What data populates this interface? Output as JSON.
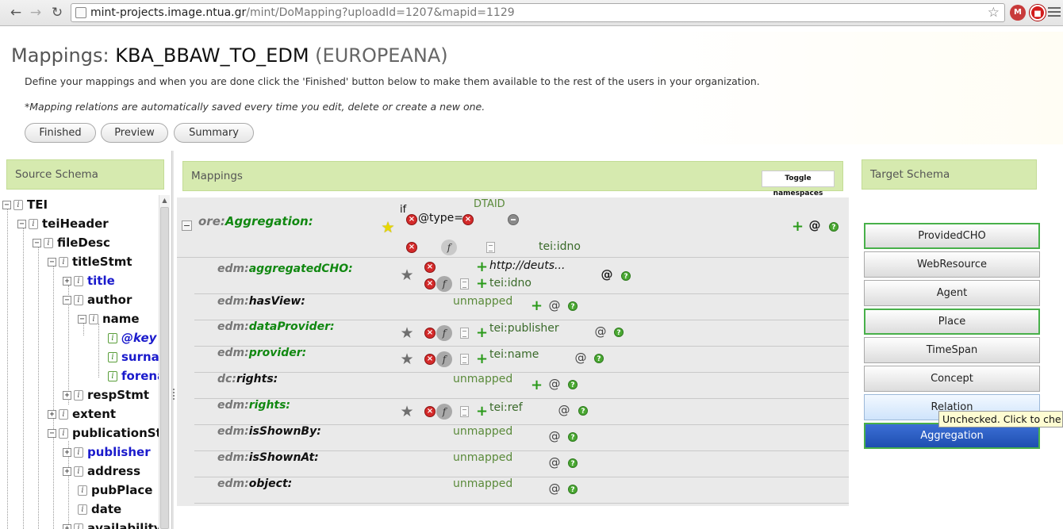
{
  "browser": {
    "url_host": "mint-projects.image.ntua.gr",
    "url_path": "/mint/DoMapping?uploadId=1207&mapid=1129"
  },
  "header": {
    "title_prefix": "Mappings:",
    "mapping_name": "KBA_BBAW_TO_EDM",
    "schema_name": "(EUROPEANA)",
    "intro": "Define your mappings and when you are done click the 'Finished' button below to make them available to the rest of the users in your organization.",
    "note": "*Mapping relations are automatically saved every time you edit, delete or create a new one.",
    "buttons": {
      "finished": "Finished",
      "preview": "Preview",
      "summary": "Summary"
    }
  },
  "source": {
    "title": "Source Schema",
    "tree": [
      {
        "label": "TEI"
      },
      {
        "label": "teiHeader"
      },
      {
        "label": "fileDesc"
      },
      {
        "label": "titleStmt"
      },
      {
        "label": "title"
      },
      {
        "label": "author"
      },
      {
        "label": "name"
      },
      {
        "label": "@key"
      },
      {
        "label": "surna"
      },
      {
        "label": "forena"
      },
      {
        "label": "respStmt"
      },
      {
        "label": "extent"
      },
      {
        "label": "publicationSt"
      },
      {
        "label": "publisher"
      },
      {
        "label": "address"
      },
      {
        "label": "pubPlace"
      },
      {
        "label": "date"
      },
      {
        "label": "availability"
      }
    ]
  },
  "mappings": {
    "title": "Mappings",
    "toggle_namespaces": "Toggle namespaces",
    "root": {
      "ns": "ore",
      "element": "Aggregation:",
      "condition_if": "if",
      "condition_attr": "@type=",
      "condition_value": "DTAID",
      "xpath": "tei:idno"
    },
    "rows": [
      {
        "ns": "edm",
        "element": "aggregatedCHO:",
        "values": [
          "http://deuts...",
          "tei:idno"
        ]
      },
      {
        "ns": "edm",
        "element": "hasView:",
        "values": [
          "unmapped"
        ]
      },
      {
        "ns": "edm",
        "element": "dataProvider:",
        "values": [
          "tei:publisher"
        ]
      },
      {
        "ns": "edm",
        "element": "provider:",
        "values": [
          "tei:name"
        ]
      },
      {
        "ns": "dc",
        "element": "rights:",
        "values": [
          "unmapped"
        ]
      },
      {
        "ns": "edm",
        "element": "rights:",
        "values": [
          "tei:ref"
        ]
      },
      {
        "ns": "edm",
        "element": "isShownBy:",
        "values": [
          "unmapped"
        ]
      },
      {
        "ns": "edm",
        "element": "isShownAt:",
        "values": [
          "unmapped"
        ]
      },
      {
        "ns": "edm",
        "element": "object:",
        "values": [
          "unmapped"
        ]
      }
    ]
  },
  "target": {
    "title": "Target Schema",
    "classes": [
      "ProvidedCHO",
      "WebResource",
      "Agent",
      "Place",
      "TimeSpan",
      "Concept",
      "Relation",
      "Aggregation"
    ],
    "tooltip": "Unchecked.  Click to che"
  },
  "icons": {
    "remove": "remove-icon",
    "function": "function-icon",
    "xpath": "xpath-doc-icon",
    "add": "add-icon",
    "attribute": "attribute-icon",
    "help": "help-icon",
    "star": "star-icon"
  }
}
